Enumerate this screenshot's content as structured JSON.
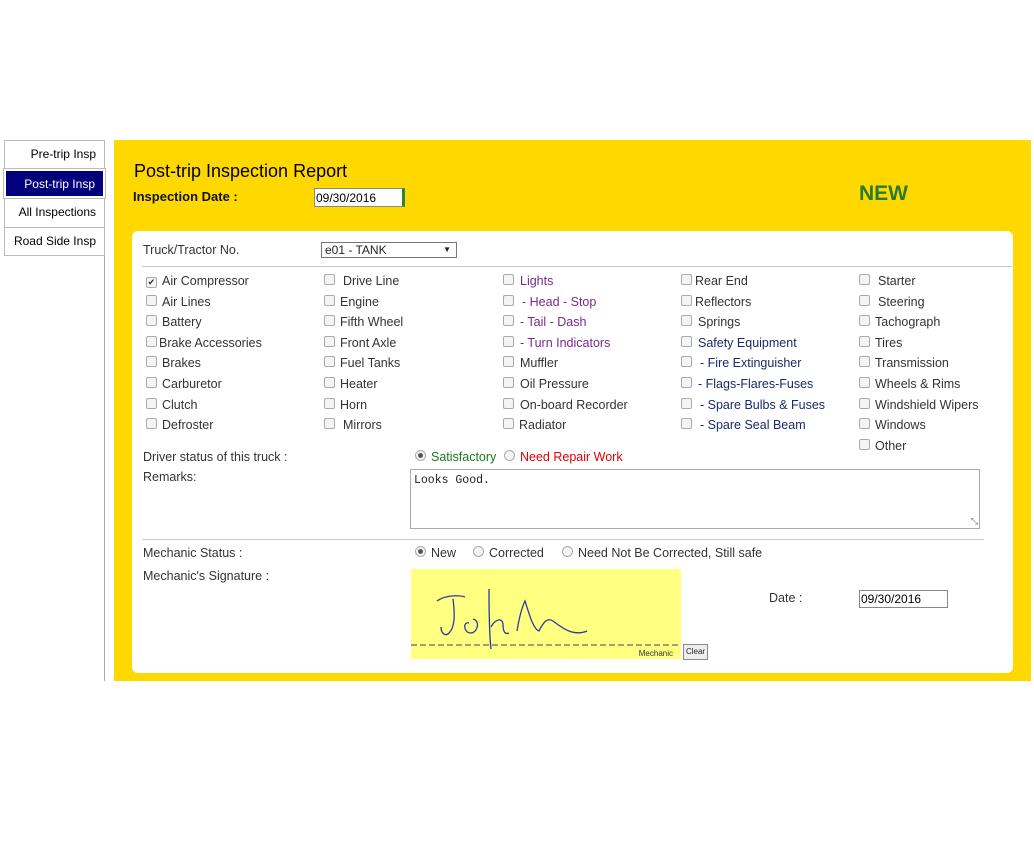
{
  "nav": {
    "items": [
      {
        "label": "Pre-trip Insp",
        "active": false
      },
      {
        "label": "Post-trip Insp",
        "active": true
      },
      {
        "label": "All Inspections",
        "active": false
      },
      {
        "label": "Road Side Insp",
        "active": false
      }
    ]
  },
  "header": {
    "title": "Post-trip Inspection Report",
    "date_label": "Inspection Date :",
    "date_value": "09/30/2016",
    "status": "NEW"
  },
  "truck": {
    "label": "Truck/Tractor No.",
    "selected": "e01 - TANK"
  },
  "checklist": {
    "col1": [
      {
        "label": "Air Compressor",
        "checked": true
      },
      {
        "label": "Air Lines",
        "checked": false
      },
      {
        "label": "Battery",
        "checked": false
      },
      {
        "label": "Brake Accessories",
        "checked": false
      },
      {
        "label": "Brakes",
        "checked": false
      },
      {
        "label": "Carburetor",
        "checked": false
      },
      {
        "label": "Clutch",
        "checked": false
      },
      {
        "label": "Defroster",
        "checked": false
      }
    ],
    "col2": [
      {
        "label": "Drive Line",
        "checked": false
      },
      {
        "label": "Engine",
        "checked": false
      },
      {
        "label": "Fifth Wheel",
        "checked": false
      },
      {
        "label": "Front Axle",
        "checked": false
      },
      {
        "label": "Fuel Tanks",
        "checked": false
      },
      {
        "label": "Heater",
        "checked": false
      },
      {
        "label": "Horn",
        "checked": false
      },
      {
        "label": "Mirrors",
        "checked": false
      }
    ],
    "col3": [
      {
        "label": "Lights",
        "checked": false
      },
      {
        "label": "- Head - Stop",
        "checked": false
      },
      {
        "label": "- Tail - Dash",
        "checked": false
      },
      {
        "label": "- Turn Indicators",
        "checked": false
      },
      {
        "label": "Muffler",
        "checked": false
      },
      {
        "label": "Oil Pressure",
        "checked": false
      },
      {
        "label": "On-board Recorder",
        "checked": false
      },
      {
        "label": "Radiator",
        "checked": false
      }
    ],
    "col4": [
      {
        "label": "Rear End",
        "checked": false
      },
      {
        "label": "Reflectors",
        "checked": false
      },
      {
        "label": "Springs",
        "checked": false
      },
      {
        "label": "Safety Equipment",
        "checked": false
      },
      {
        "label": "- Fire Extinguisher",
        "checked": false
      },
      {
        "label": "- Flags-Flares-Fuses",
        "checked": false
      },
      {
        "label": "- Spare Bulbs & Fuses",
        "checked": false
      },
      {
        "label": "- Spare Seal Beam",
        "checked": false
      }
    ],
    "col5": [
      {
        "label": "Starter",
        "checked": false
      },
      {
        "label": "Steering",
        "checked": false
      },
      {
        "label": "Tachograph",
        "checked": false
      },
      {
        "label": "Tires",
        "checked": false
      },
      {
        "label": "Transmission",
        "checked": false
      },
      {
        "label": "Wheels & Rims",
        "checked": false
      },
      {
        "label": "Windshield Wipers",
        "checked": false
      },
      {
        "label": "Windows",
        "checked": false
      },
      {
        "label": "Other",
        "checked": false
      }
    ]
  },
  "driver_status": {
    "label": "Driver status of this truck :",
    "options": [
      "Satisfactory",
      "Need Repair Work"
    ],
    "selected": "Satisfactory"
  },
  "remarks": {
    "label": "Remarks:",
    "value": "Looks Good."
  },
  "mechanic": {
    "status_label": "Mechanic Status :",
    "status_options": [
      "New",
      "Corrected",
      "Need Not Be Corrected, Still safe"
    ],
    "status_selected": "New",
    "signature_label": "Mechanic's Signature :",
    "signature_line_label": "Mechanic",
    "clear_label": "Clear",
    "date_label": "Date :",
    "date_value": "09/30/2016"
  },
  "colors": {
    "panel_bg": "#ffd800",
    "nav_active_bg": "#02007a",
    "status_new": "#2a7a2a",
    "satisfactory": "#1a7a1a",
    "need_repair": "#e00000",
    "signature_pad": "#ffff80"
  }
}
